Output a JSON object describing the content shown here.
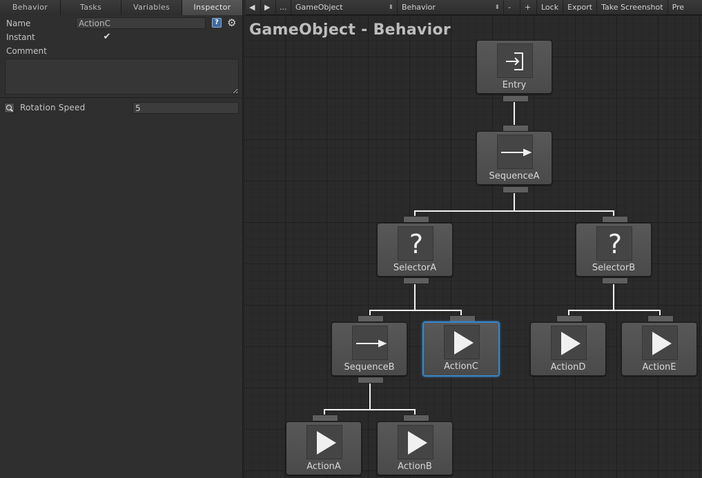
{
  "tabs": [
    "Behavior",
    "Tasks",
    "Variables",
    "Inspector"
  ],
  "active_tab": "Inspector",
  "inspector": {
    "name_label": "Name",
    "name_value": "ActionC",
    "instant_label": "Instant",
    "instant_checked": true,
    "comment_label": "Comment",
    "comment_value": "",
    "field_label": "Rotation Speed",
    "field_value": "5"
  },
  "toolbar": {
    "back": "◀",
    "forward": "▶",
    "more": "...",
    "object_select": "GameObject",
    "behavior_select": "Behavior",
    "add": "-",
    "remove": "+",
    "lock": "Lock",
    "export": "Export",
    "screenshot": "Take Screenshot",
    "cut_label": "Pre"
  },
  "graph": {
    "title": "GameObject - Behavior",
    "nodes": [
      {
        "id": "entry",
        "label": "Entry",
        "icon": "entry-icon"
      },
      {
        "id": "sequenceA",
        "label": "SequenceA",
        "icon": "sequence-arrow-icon"
      },
      {
        "id": "selectorA",
        "label": "SelectorA",
        "icon": "selector-question-icon"
      },
      {
        "id": "selectorB",
        "label": "SelectorB",
        "icon": "selector-question-icon"
      },
      {
        "id": "sequenceB",
        "label": "SequenceB",
        "icon": "sequence-arrow-icon"
      },
      {
        "id": "actionC",
        "label": "ActionC",
        "icon": "action-play-icon",
        "selected": true
      },
      {
        "id": "actionD",
        "label": "ActionD",
        "icon": "action-play-icon"
      },
      {
        "id": "actionE",
        "label": "ActionE",
        "icon": "action-play-icon"
      },
      {
        "id": "actionA",
        "label": "ActionA",
        "icon": "action-play-icon"
      },
      {
        "id": "actionB",
        "label": "ActionB",
        "icon": "action-play-icon"
      }
    ],
    "selection_color": "#3b84c7"
  }
}
